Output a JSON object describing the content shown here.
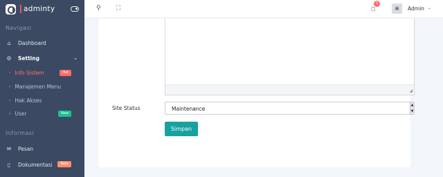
{
  "brand": {
    "name": "adminty"
  },
  "sidebar": {
    "section_nav": "Navigasi",
    "section_info": "Informasi",
    "dashboard": "Dashboard",
    "setting": "Setting",
    "sub_items": [
      {
        "label": "Info Sistem",
        "badge": "Hot",
        "active": true
      },
      {
        "label": "Manajemen Menu",
        "badge": ""
      },
      {
        "label": "Hak Akses",
        "badge": ""
      },
      {
        "label": "User",
        "badge": "New"
      }
    ],
    "pesan": "Pesan",
    "dokumentasi": "Dokumentasi",
    "dokumentasi_badge": "Beta"
  },
  "topbar": {
    "notification_count": "3",
    "admin_name": "Admin"
  },
  "form": {
    "site_status_label": "Site Status",
    "site_status_value": "Maintenance",
    "save_label": "Simpan"
  },
  "colors": {
    "sidebar_bg": "#3b4a62",
    "accent_active": "#ff6f6f",
    "button_teal": "#17a2a0",
    "badge_hot": "#ff6b6b",
    "badge_new": "#19c38c"
  }
}
